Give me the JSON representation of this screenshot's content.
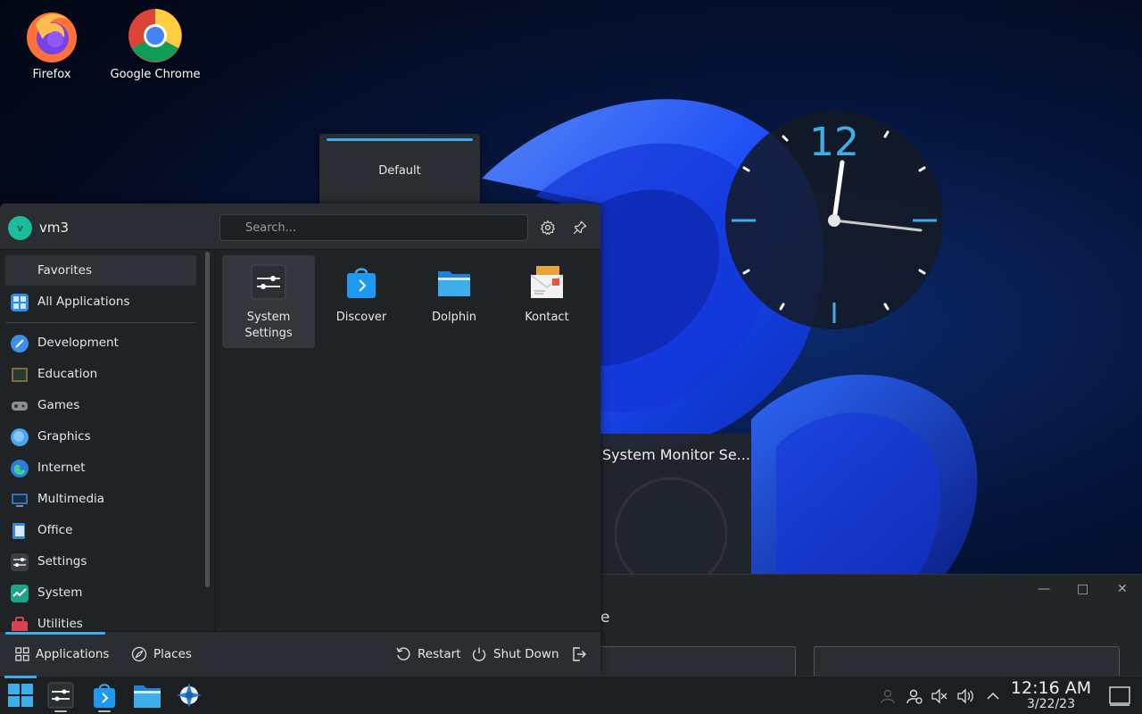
{
  "desktop": {
    "icons": [
      {
        "label": "Firefox"
      },
      {
        "label": "Google Chrome"
      }
    ],
    "clock": {
      "twelve_label": "12"
    },
    "activity_popup": {
      "label": "Default"
    },
    "system_monitor": {
      "title": "System Monitor Se..."
    },
    "background_window": {
      "title_fragment": "e"
    }
  },
  "launcher": {
    "user": {
      "initial": "v",
      "name": "vm3"
    },
    "search": {
      "placeholder": "Search...",
      "value": ""
    },
    "sidebar": {
      "items": [
        {
          "label": "Favorites",
          "icon": "favorites-icon",
          "selected": true
        },
        {
          "label": "All Applications",
          "icon": "grid-icon"
        },
        {
          "label": "Development",
          "icon": "development-icon"
        },
        {
          "label": "Education",
          "icon": "education-icon"
        },
        {
          "label": "Games",
          "icon": "gamepad-icon"
        },
        {
          "label": "Graphics",
          "icon": "graphics-icon"
        },
        {
          "label": "Internet",
          "icon": "globe-icon"
        },
        {
          "label": "Multimedia",
          "icon": "multimedia-icon"
        },
        {
          "label": "Office",
          "icon": "office-icon"
        },
        {
          "label": "Settings",
          "icon": "settings-sliders-icon"
        },
        {
          "label": "System",
          "icon": "system-icon"
        },
        {
          "label": "Utilities",
          "icon": "toolbox-icon"
        }
      ]
    },
    "favorites": [
      {
        "label": "System Settings",
        "icon": "system-settings-icon"
      },
      {
        "label": "Discover",
        "icon": "discover-bag-icon"
      },
      {
        "label": "Dolphin",
        "icon": "folder-icon"
      },
      {
        "label": "Kontact",
        "icon": "kontact-mail-icon"
      }
    ],
    "footer": {
      "applications_tab": "Applications",
      "places_tab": "Places",
      "restart": "Restart",
      "shutdown": "Shut Down"
    }
  },
  "taskbar": {
    "time": "12:16 AM",
    "date": "3/22/23"
  },
  "colors": {
    "accent": "#3daee9",
    "panel": "#202326",
    "header": "#2a2e32"
  }
}
